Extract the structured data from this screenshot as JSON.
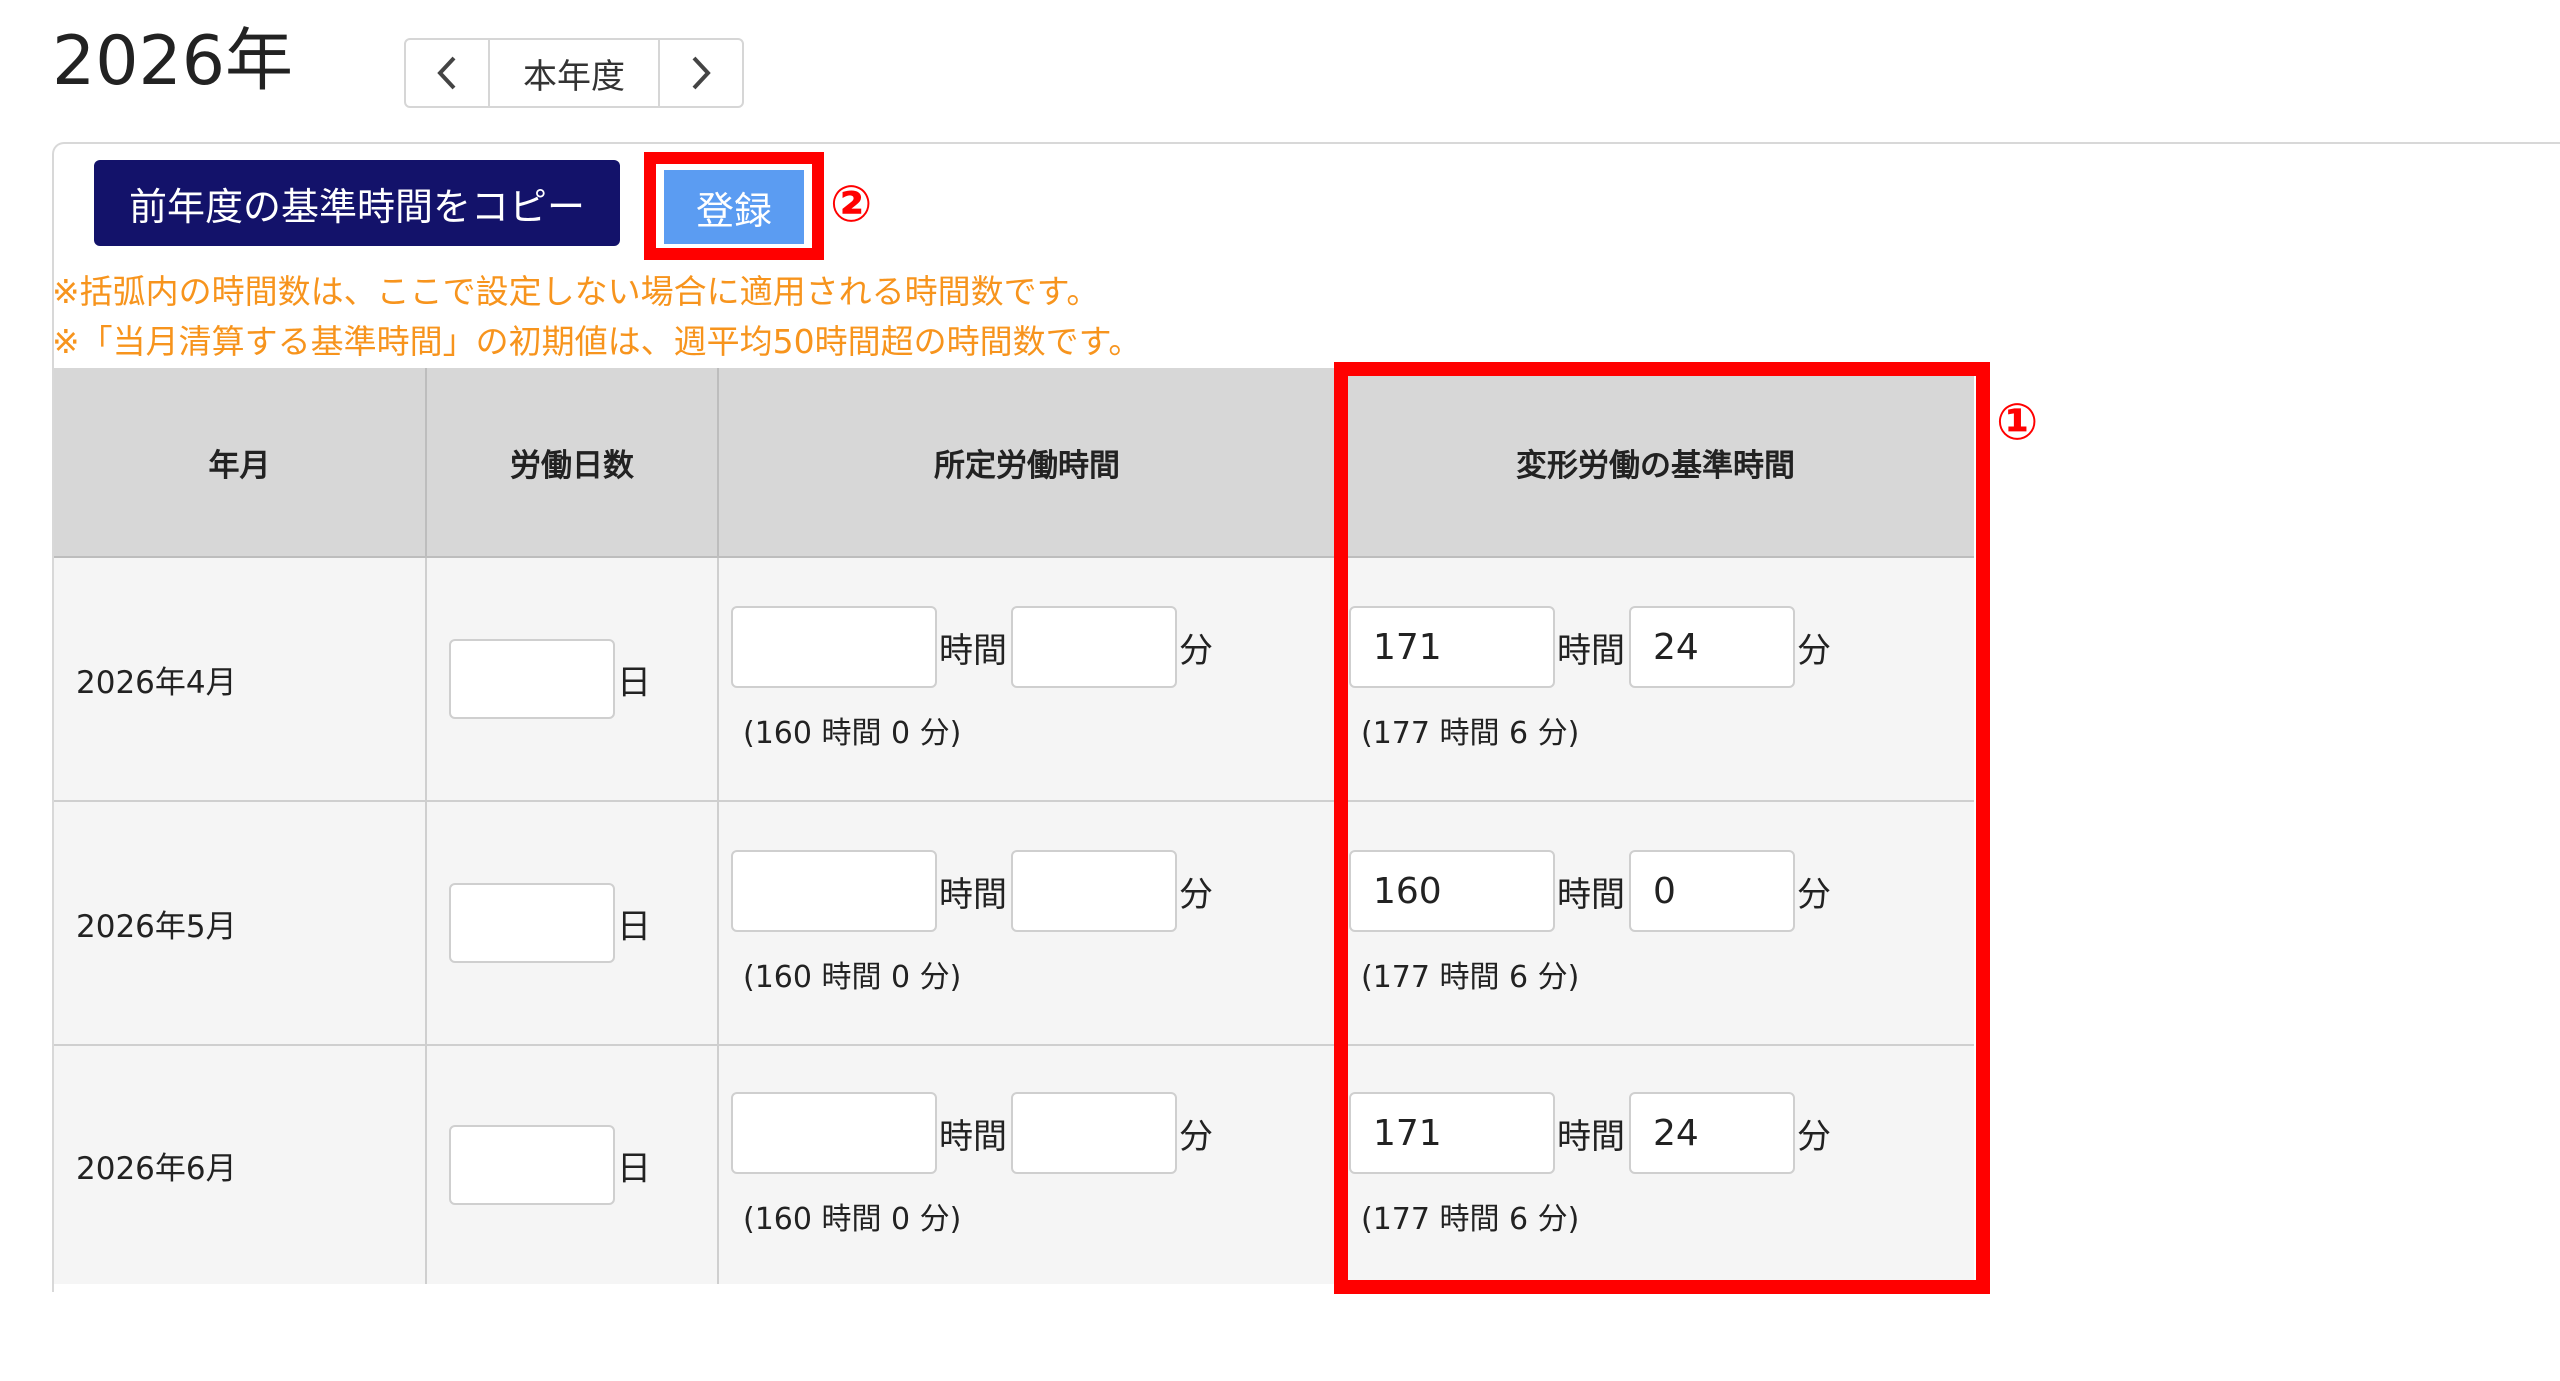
{
  "header": {
    "year": "2026年",
    "nav_current_label": "本年度"
  },
  "toolbar": {
    "copy_label": "前年度の基準時間をコピー",
    "register_label": "登録",
    "marker_register": "②",
    "marker_column": "①"
  },
  "notes": [
    "※括弧内の時間数は、ここで設定しない場合に適用される時間数です。",
    "※「当月清算する基準時間」の初期値は、週平均50時間超の時間数です。"
  ],
  "table": {
    "headers": [
      "年月",
      "労働日数",
      "所定労働時間",
      "変形労働の基準時間"
    ],
    "unit_day": "日",
    "unit_hour": "時間",
    "unit_min": "分",
    "rows": [
      {
        "month": "2026年4月",
        "days": "",
        "std_hours": "",
        "std_minutes": "",
        "std_hint": "(160 時間 0 分)",
        "var_hours": "171",
        "var_minutes": "24",
        "var_hint": "(177 時間 6 分)"
      },
      {
        "month": "2026年5月",
        "days": "",
        "std_hours": "",
        "std_minutes": "",
        "std_hint": "(160 時間 0 分)",
        "var_hours": "160",
        "var_minutes": "0",
        "var_hint": "(177 時間 6 分)"
      },
      {
        "month": "2026年6月",
        "days": "",
        "std_hours": "",
        "std_minutes": "",
        "std_hint": "(160 時間 0 分)",
        "var_hours": "171",
        "var_minutes": "24",
        "var_hint": "(177 時間 6 分)"
      }
    ]
  },
  "colors": {
    "copy_button_bg": "#13126a",
    "register_button_bg": "#5b9cf2",
    "highlight": "#ff0000",
    "note_text": "#f7941d",
    "header_bg": "#d7d7d7"
  }
}
